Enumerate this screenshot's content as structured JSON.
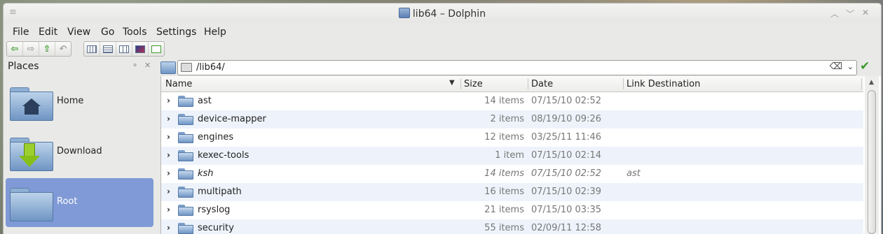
{
  "window": {
    "title": "lib64 – Dolphin",
    "controls": [
      "minimize",
      "maximize",
      "close"
    ]
  },
  "menubar": {
    "items": [
      "File",
      "Edit",
      "View",
      "Go",
      "Tools",
      "Settings",
      "Help"
    ]
  },
  "toolbar": {
    "icons": [
      "back-icon",
      "forward-icon",
      "up-icon",
      "undo-icon",
      "icons-view-icon",
      "details-view-icon",
      "columns-view-icon",
      "preview-icon",
      "split-view-icon"
    ]
  },
  "places": {
    "title": "Places",
    "items": [
      {
        "label": "Home",
        "selected": false
      },
      {
        "label": "Download",
        "selected": false
      },
      {
        "label": "Root",
        "selected": true
      }
    ]
  },
  "location": {
    "path": "/lib64/"
  },
  "table": {
    "columns": [
      "Name",
      "Size",
      "Date",
      "Link Destination"
    ],
    "rows": [
      {
        "name": "ast",
        "size": "14 items",
        "date": "07/15/10 02:52",
        "link": ""
      },
      {
        "name": "device-mapper",
        "size": "2 items",
        "date": "08/19/10 09:26",
        "link": ""
      },
      {
        "name": "engines",
        "size": "12 items",
        "date": "03/25/11 11:46",
        "link": ""
      },
      {
        "name": "kexec-tools",
        "size": "1 item",
        "date": "07/15/10 02:14",
        "link": ""
      },
      {
        "name": "ksh",
        "size": "14 items",
        "date": "07/15/10 02:52",
        "link": "ast",
        "is_link": true
      },
      {
        "name": "multipath",
        "size": "16 items",
        "date": "07/15/10 02:39",
        "link": ""
      },
      {
        "name": "rsyslog",
        "size": "21 items",
        "date": "07/15/10 03:35",
        "link": ""
      },
      {
        "name": "security",
        "size": "55 items",
        "date": "02/09/11 12:58",
        "link": ""
      }
    ]
  },
  "colors": {
    "selection": "#7f9ad6",
    "alt_row": "#eef3fb",
    "accent_green": "#3d9a2b"
  }
}
